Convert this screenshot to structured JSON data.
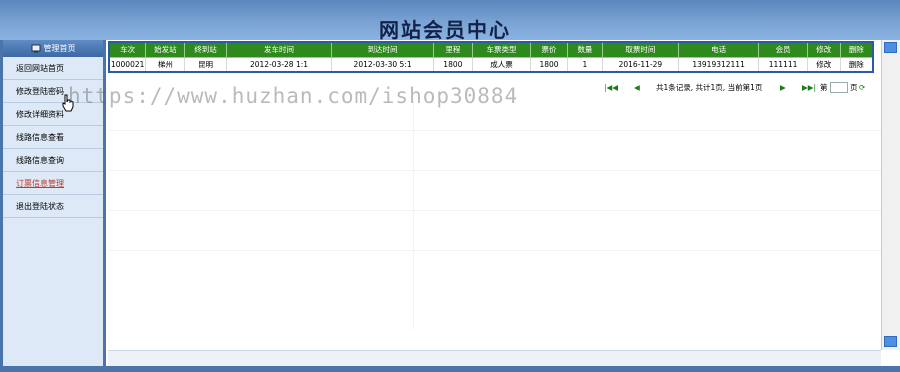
{
  "header": {
    "title": "网站会员中心"
  },
  "sidebar": {
    "head_label": "管理首页",
    "items": [
      {
        "label": "返回网站首页"
      },
      {
        "label": "修改登陆密码"
      },
      {
        "label": "修改详细资料"
      },
      {
        "label": "线路信息查看"
      },
      {
        "label": "线路信息查询"
      },
      {
        "label": "订票信息管理"
      },
      {
        "label": "退出登陆状态"
      }
    ]
  },
  "table": {
    "columns": [
      "车次",
      "始发站",
      "终到站",
      "发车时间",
      "到达时间",
      "里程",
      "车票类型",
      "票价",
      "数量",
      "取票时间",
      "电话",
      "会员",
      "修改",
      "删除"
    ],
    "rows": [
      [
        "1000021",
        "梯州",
        "昆明",
        "2012-03-28 1:1",
        "2012-03-30 5:1",
        "1800",
        "成人票",
        "1800",
        "1",
        "2016-11-29",
        "13919312111",
        "111111",
        "修改",
        "删除"
      ]
    ]
  },
  "pager": {
    "summary": "共1条记录, 共计1页, 当前第1页",
    "first": "|◀◀",
    "prev": "◀",
    "next": "▶",
    "last": "▶▶|",
    "goto_prefix": "第",
    "goto_suffix": "页",
    "page_value": ""
  },
  "watermark": "https://www.huzhan.com/ishop30884",
  "colors": {
    "header": "#6d96cb",
    "table_header": "#2f8a1e",
    "active_nav": "#c0392b"
  }
}
